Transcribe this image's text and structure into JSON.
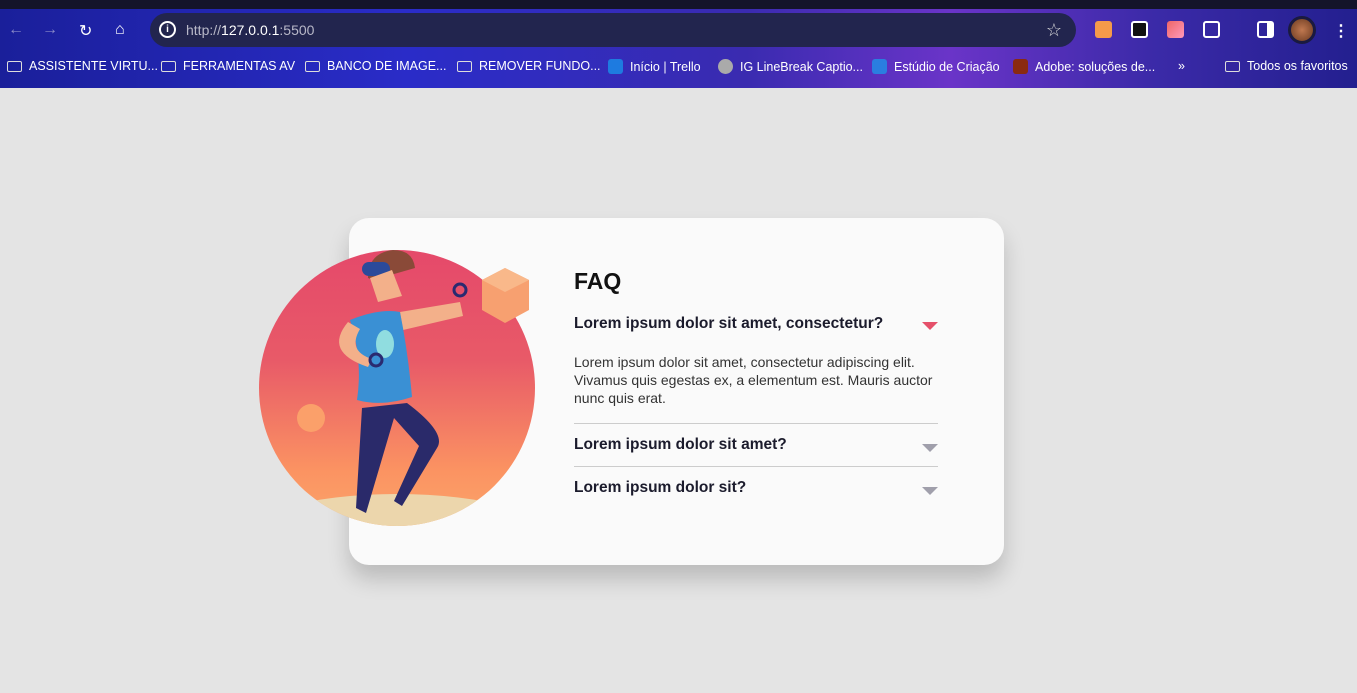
{
  "browser": {
    "url_prefix": "http://",
    "url_host": "127.0.0.1",
    "url_port": ":5500",
    "bookmarks": [
      {
        "label": "ASSISTENTE VIRTU...",
        "icon": "folder-icon"
      },
      {
        "label": "FERRAMENTAS AV",
        "icon": "folder-icon"
      },
      {
        "label": "BANCO DE IMAGE...",
        "icon": "folder-icon"
      },
      {
        "label": "REMOVER FUNDO...",
        "icon": "folder-icon"
      },
      {
        "label": "Início | Trello",
        "icon": "trello-icon"
      },
      {
        "label": "IG LineBreak Captio...",
        "icon": "globe-icon"
      },
      {
        "label": "Estúdio de Criação",
        "icon": "studio-icon"
      },
      {
        "label": "Adobe: soluções de...",
        "icon": "adobe-icon"
      }
    ],
    "all_bookmarks": "Todos os favoritos"
  },
  "faq": {
    "title": "FAQ",
    "accent": "#e5506a",
    "items": [
      {
        "question": "Lorem ipsum dolor sit amet, consectetur?",
        "answer": "Lorem ipsum dolor sit amet, consectetur adipiscing elit. Vivamus quis egestas ex, a elementum est. Mauris auctor nunc quis erat.",
        "open": true
      },
      {
        "question": "Lorem ipsum dolor sit amet?",
        "open": false
      },
      {
        "question": "Lorem ipsum dolor sit?",
        "open": false
      }
    ]
  }
}
